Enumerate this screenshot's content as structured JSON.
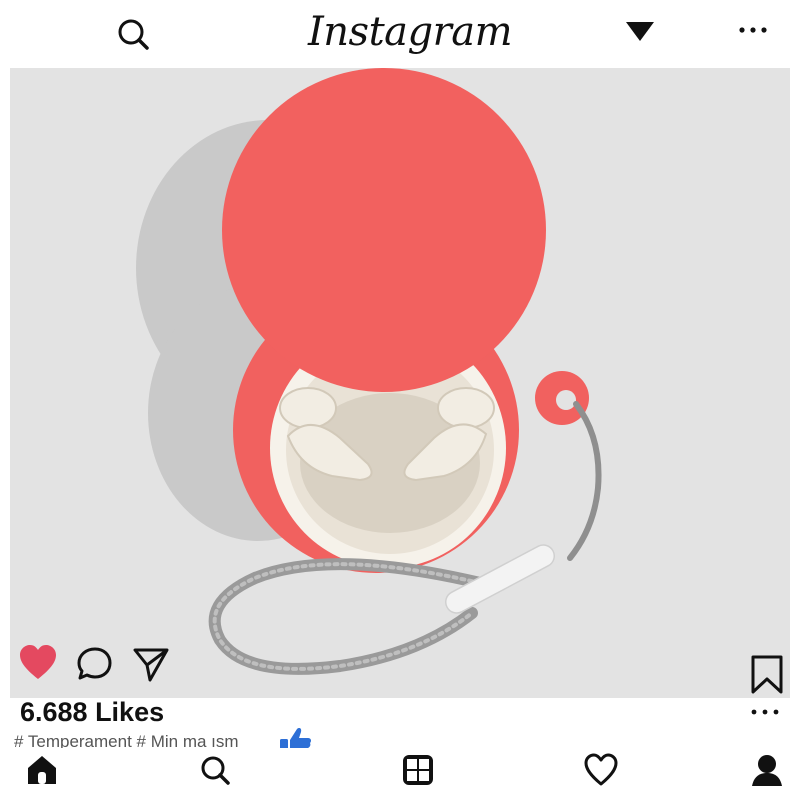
{
  "header": {
    "brand": "Instagram",
    "icons": [
      "search-icon",
      "dropdown-triangle-icon",
      "more-horizontal-icon"
    ]
  },
  "post": {
    "image_subject": "coral-red round earbud case with lid open, two white earbuds, grey braided lanyard",
    "colors": {
      "case": "#f1615f",
      "background": "#e3e3e3",
      "earbuds": "#efe9de",
      "like": "#e44960"
    },
    "actions": {
      "liked": true,
      "icons": [
        "heart-icon",
        "comment-icon",
        "share-icon",
        "bookmark-icon"
      ]
    },
    "likes": "6.688 Likes",
    "hashtags": "# Temperament # Min ma ısm"
  },
  "bottom_nav": {
    "items": [
      "home-icon",
      "search-icon",
      "reels-icon",
      "activity-heart-icon",
      "profile-icon"
    ]
  }
}
